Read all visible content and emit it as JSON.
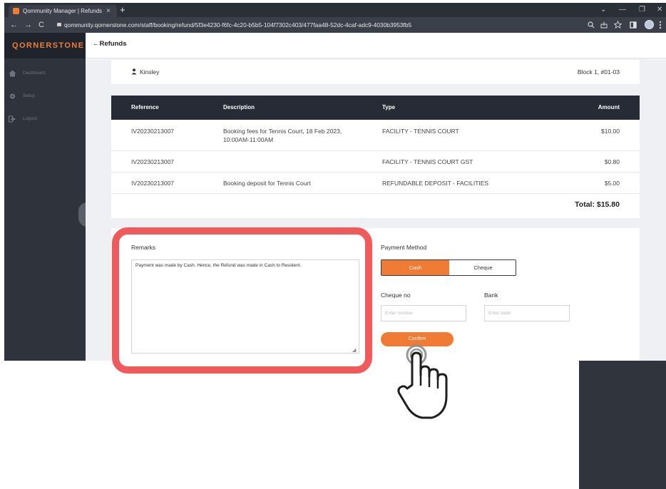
{
  "browser": {
    "tab_title": "Qommunity Manager | Refunds",
    "tab_close": "×",
    "new_tab": "+",
    "url": "qommunity.qornerstone.com/staff/booking/refund/5f3e4230-f6fc-4c20-b5b5-104f7302c403/477faa48-52dc-4caf-adc9-4030b3953fb5",
    "nav": {
      "back": "←",
      "forward": "→",
      "reload": "C"
    },
    "window": {
      "minimize": "—",
      "chevron": "⌄",
      "restore": "❐",
      "close": "✕"
    }
  },
  "sidebar": {
    "logo": "QORNERSTONE",
    "items": [
      {
        "label": "Dashboard",
        "icon": "home-icon"
      },
      {
        "label": "Setup",
        "icon": "gear-icon"
      },
      {
        "label": "Logout",
        "icon": "logout-icon"
      }
    ]
  },
  "header": {
    "back_label": "←Refunds"
  },
  "resident": {
    "name": "Kinsley",
    "unit": "Block 1, #01-03"
  },
  "table": {
    "headers": {
      "reference": "Reference",
      "description": "Description",
      "type": "Type",
      "amount": "Amount"
    },
    "rows": [
      {
        "reference": "IV20230213007",
        "description": "Booking fees for Tennis Court, 18 Feb 2023, 10:00AM-11:00AM",
        "type": "FACILITY - TENNIS COURT",
        "amount": "$10.00"
      },
      {
        "reference": "IV20230213007",
        "description": "",
        "type": "FACILITY - TENNIS COURT GST",
        "amount": "$0.80"
      },
      {
        "reference": "IV20230213007",
        "description": "Booking deposit for Tennis Court",
        "type": "REFUNDABLE DEPOSIT - FACILITIES",
        "amount": "$5.00"
      }
    ],
    "total": "Total: $15.80"
  },
  "form": {
    "remarks_label": "Remarks",
    "remarks_value": "Payment was made by Cash. Hence, the Refund was made in Cash to Resident.",
    "payment_method_label": "Payment Method",
    "cash_label": "Cash",
    "cheque_label": "Cheque",
    "cheque_no_label": "Cheque no",
    "cheque_no_placeholder": "Enter number",
    "bank_label": "Bank",
    "bank_placeholder": "Enter bank",
    "confirm_label": "Confirm"
  },
  "colors": {
    "accent": "#f07b34",
    "highlight": "#f05a5a",
    "sidebar": "#2e333c",
    "table_header": "#262b35"
  }
}
